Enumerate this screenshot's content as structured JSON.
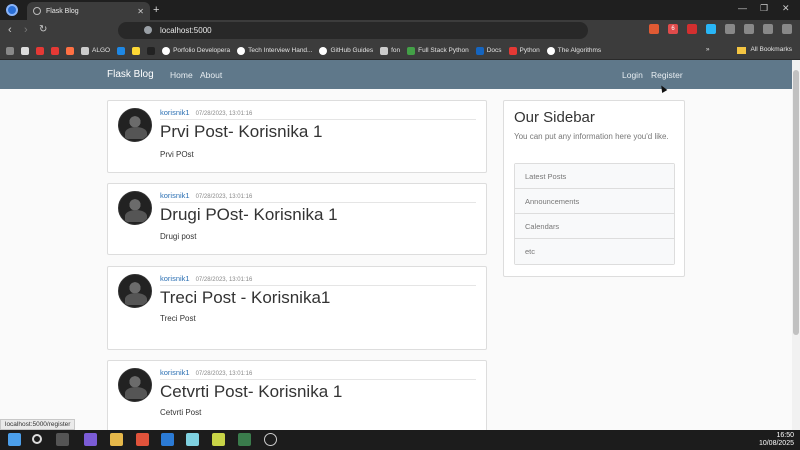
{
  "browser": {
    "tab_title": "Flask Blog",
    "url": "localhost:5000",
    "new_tab_symbol": "+",
    "bookmarks": [
      "ALGO",
      "Porfolio Developera",
      "Tech Interview Hand...",
      "GitHub Guides",
      "fon",
      "Full Stack Python",
      "Docs",
      "Python",
      "The Algorithms"
    ],
    "all_bookmarks_label": "All Bookmarks",
    "more_symbol": "»",
    "badge_count": "6"
  },
  "navbar": {
    "brand": "Flask Blog",
    "links_left": [
      "Home",
      "About"
    ],
    "links_right": [
      "Login",
      "Register"
    ]
  },
  "posts": [
    {
      "author": "korisnik1",
      "date": "07/28/2023, 13:01:16",
      "title": "Prvi Post- Korisnika 1",
      "content": "Prvi POst"
    },
    {
      "author": "korisnik1",
      "date": "07/28/2023, 13:01:16",
      "title": "Drugi POst- Korisnika 1",
      "content": "Drugi post"
    },
    {
      "author": "korisnik1",
      "date": "07/28/2023, 13:01:16",
      "title": "Treci Post - Korisnika1",
      "content": "Treci Post"
    },
    {
      "author": "korisnik1",
      "date": "07/28/2023, 13:01:16",
      "title": "Cetvrti Post- Korisnika 1",
      "content": "Cetvrti Post"
    }
  ],
  "sidebar": {
    "title": "Our Sidebar",
    "text": "You can put any information here you'd like.",
    "items": [
      "Latest Posts",
      "Announcements",
      "Calendars",
      "etc"
    ]
  },
  "status_url": "localhost:5000/register",
  "clock": {
    "time": "16:50",
    "date": "10/08/2025"
  }
}
